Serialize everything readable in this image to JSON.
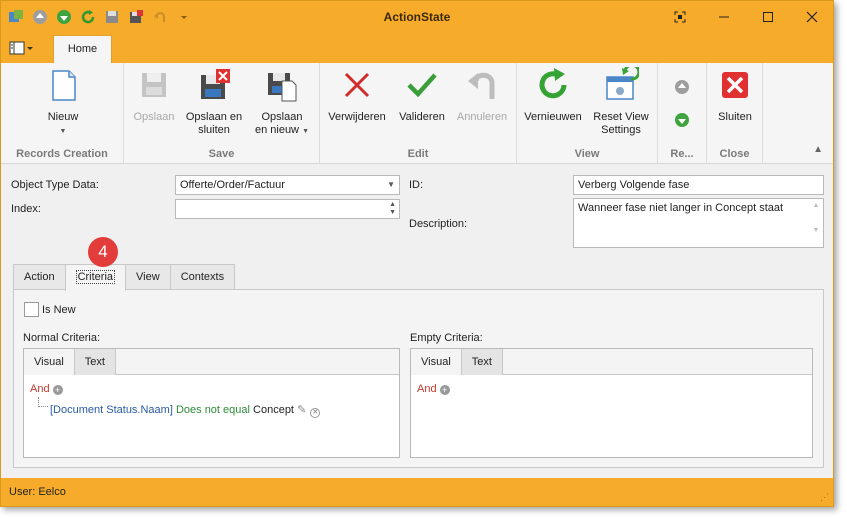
{
  "window": {
    "title": "ActionState"
  },
  "quick_access": [
    "app-icon",
    "up-icon",
    "down-icon",
    "refresh-icon",
    "save-icon",
    "save-close-icon",
    "undo-icon",
    "customize-icon"
  ],
  "ribbon": {
    "tab": "Home",
    "groups": {
      "records_creation": "Records Creation",
      "save": "Save",
      "edit": "Edit",
      "view": "View",
      "records": "Re...",
      "close": "Close"
    },
    "buttons": {
      "new": "Nieuw",
      "save": "Opslaan",
      "save_close_1": "Opslaan en",
      "save_close_2": "sluiten",
      "save_new_1": "Opslaan",
      "save_new_2": "en nieuw",
      "delete": "Verwijderen",
      "validate": "Valideren",
      "cancel": "Annuleren",
      "refresh": "Vernieuwen",
      "reset_view_1": "Reset View",
      "reset_view_2": "Settings",
      "close": "Sluiten"
    }
  },
  "form": {
    "object_type_label": "Object Type Data:",
    "object_type_value": "Offerte/Order/Factuur",
    "index_label": "Index:",
    "index_value": "",
    "id_label": "ID:",
    "id_value": "Verberg Volgende fase",
    "description_label": "Description:",
    "description_value": "Wanneer fase niet langer in Concept staat"
  },
  "tabs": [
    "Action",
    "Criteria",
    "View",
    "Contexts"
  ],
  "active_tab": "Criteria",
  "badge": "4",
  "criteria": {
    "is_new_label": "Is New",
    "is_new_checked": false,
    "normal_label": "Normal Criteria:",
    "empty_label": "Empty Criteria:",
    "subtabs": [
      "Visual",
      "Text"
    ],
    "normal_expression": {
      "group": "And",
      "field": "[Document Status.Naam]",
      "operator": "Does not equal",
      "value": "Concept"
    },
    "empty_expression": {
      "group": "And"
    }
  },
  "status": {
    "user": "User: Eelco"
  },
  "colors": {
    "accent": "#f7ab2a",
    "badge": "#e33d3b"
  }
}
